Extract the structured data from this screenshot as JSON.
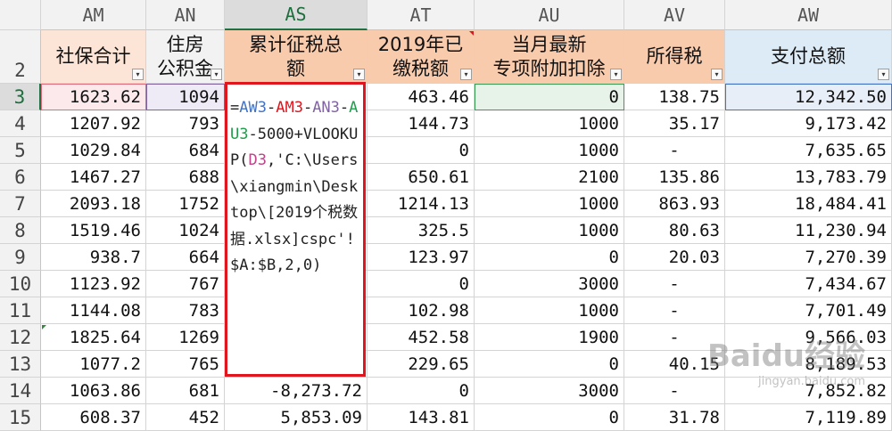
{
  "columns": [
    {
      "id": "AM",
      "hdr_lines": [
        "社保合计"
      ],
      "bg": "#fce4d6",
      "has_filter": true
    },
    {
      "id": "AN",
      "hdr_lines": [
        "住房",
        "公积金"
      ],
      "bg": "#f2f2f2",
      "has_filter": true
    },
    {
      "id": "AS",
      "hdr_lines": [
        "累计征税总",
        "额"
      ],
      "bg": "#f8cbad",
      "has_filter": true,
      "selected": true
    },
    {
      "id": "AT",
      "hdr_lines": [
        "2019年已",
        "缴税额"
      ],
      "bg": "#f8cbad",
      "has_filter": true
    },
    {
      "id": "AU",
      "hdr_lines": [
        "当月最新",
        "专项附加扣除"
      ],
      "bg": "#f8cbad",
      "has_filter": true
    },
    {
      "id": "AV",
      "hdr_lines": [
        "所得税"
      ],
      "bg": "#f8cbad",
      "has_filter": true
    },
    {
      "id": "AW",
      "hdr_lines": [
        "支付总额"
      ],
      "bg": "#ddebf7",
      "has_filter": true
    }
  ],
  "header_row_number": "2",
  "rows": [
    {
      "n": "3",
      "AM": "1623.62",
      "AN": "1094",
      "AS": "",
      "AT": "463.46",
      "AU": "0",
      "AV": "138.75",
      "AW": "12,342.50"
    },
    {
      "n": "4",
      "AM": "1207.92",
      "AN": "793",
      "AS": "",
      "AT": "144.73",
      "AU": "1000",
      "AV": "35.17",
      "AW": "9,173.42"
    },
    {
      "n": "5",
      "AM": "1029.84",
      "AN": "684",
      "AS": "",
      "AT": "0",
      "AU": "1000",
      "AV": "-",
      "AW": "7,635.65"
    },
    {
      "n": "6",
      "AM": "1467.27",
      "AN": "688",
      "AS": "",
      "AT": "650.61",
      "AU": "2100",
      "AV": "135.86",
      "AW": "13,783.79"
    },
    {
      "n": "7",
      "AM": "2093.18",
      "AN": "1752",
      "AS": "",
      "AT": "1214.13",
      "AU": "1000",
      "AV": "863.93",
      "AW": "18,484.41"
    },
    {
      "n": "8",
      "AM": "1519.46",
      "AN": "1024",
      "AS": "",
      "AT": "325.5",
      "AU": "1000",
      "AV": "80.63",
      "AW": "11,230.94"
    },
    {
      "n": "9",
      "AM": "938.7",
      "AN": "664",
      "AS": "",
      "AT": "123.97",
      "AU": "0",
      "AV": "20.03",
      "AW": "7,270.39"
    },
    {
      "n": "10",
      "AM": "1123.92",
      "AN": "767",
      "AS": "",
      "AT": "0",
      "AU": "3000",
      "AV": "-",
      "AW": "7,434.67"
    },
    {
      "n": "11",
      "AM": "1144.08",
      "AN": "783",
      "AS": "",
      "AT": "102.98",
      "AU": "1000",
      "AV": "-",
      "AW": "7,701.49"
    },
    {
      "n": "12",
      "AM": "1825.64",
      "AN": "1269",
      "AS": "",
      "AT": "452.58",
      "AU": "1900",
      "AV": "-",
      "AW": "9,566.03"
    },
    {
      "n": "13",
      "AM": "1077.2",
      "AN": "765",
      "AS": "",
      "AT": "229.65",
      "AU": "0",
      "AV": "40.15",
      "AW": "8,189.53"
    },
    {
      "n": "14",
      "AM": "1063.86",
      "AN": "681",
      "AS": "-8,273.72",
      "AT": "0",
      "AU": "3000",
      "AV": "-",
      "AW": "7,852.82"
    },
    {
      "n": "15",
      "AM": "608.37",
      "AN": "452",
      "AS": "5,853.09",
      "AT": "143.81",
      "AU": "0",
      "AV": "31.78",
      "AW": "7,119.89"
    }
  ],
  "active_cell": "AS3",
  "formula_tokens": [
    {
      "text": "=",
      "color": "#222222"
    },
    {
      "text": "AW3",
      "color": "#4472c4"
    },
    {
      "text": "-",
      "color": "#222222"
    },
    {
      "text": "AM3",
      "color": "#e0151d"
    },
    {
      "text": "-",
      "color": "#222222"
    },
    {
      "text": "AN3",
      "color": "#8064a2"
    },
    {
      "text": "-",
      "color": "#222222"
    },
    {
      "text": "AU3",
      "color": "#1e9e4a"
    },
    {
      "text": "-5000+VLOOKUP(",
      "color": "#222222"
    },
    {
      "text": "D3",
      "color": "#c0438b"
    },
    {
      "text": ",'C:\\Users\\xiangmin\\Desktop\\[2019个税数据.xlsx]cspc'!$A:$B,2,0)",
      "color": "#222222"
    }
  ],
  "watermark": {
    "text": "Baidu经验",
    "subtext": "jingyan.baidu.com"
  }
}
